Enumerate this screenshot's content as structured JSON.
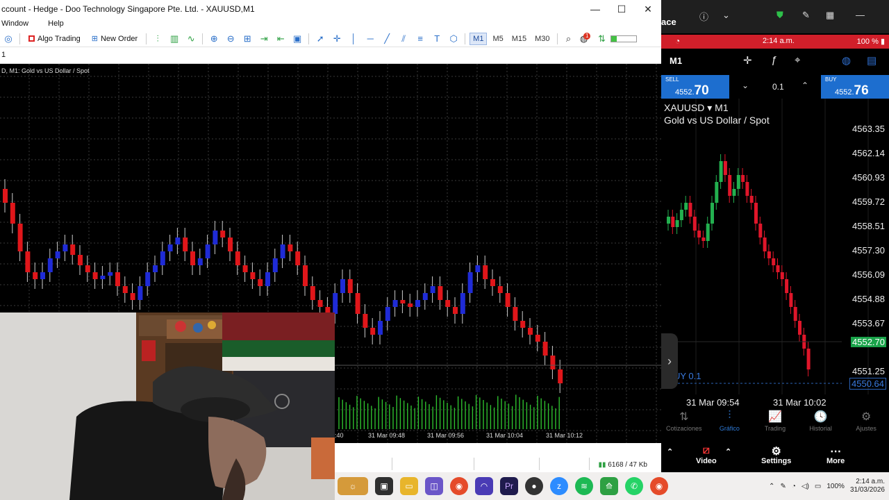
{
  "window": {
    "title": "ccount - Hedge - Doo Technology Singapore Pte. Ltd. - XAUUSD,M1",
    "minimize": "—",
    "maximize": "☐",
    "close": "✕"
  },
  "menu": [
    "Window",
    "Help"
  ],
  "toolbar": {
    "algo_trading": "Algo Trading",
    "new_order": "New Order",
    "timeframes": [
      "M1",
      "M5",
      "M15",
      "M30"
    ],
    "notification_count": "1"
  },
  "tab_row": {
    "label": "1"
  },
  "chart": {
    "label": "D, M1: Gold vs US Dollar / Spot",
    "time_labels": [
      ":40",
      "31 Mar 09:48",
      "31 Mar 09:56",
      "31 Mar 10:04",
      "31 Mar 10:12"
    ],
    "colors": {
      "bull": "#1f2bd6",
      "bear": "#e0161a",
      "volume": "#2ec02e",
      "grid": "#3a3a3a"
    }
  },
  "status": {
    "network": "6168 / 47 Kb"
  },
  "mirror": {
    "header_text": "ace",
    "phone_time": "2:14 a.m.",
    "battery": "100 %",
    "timeframe": "M1",
    "sell": {
      "label": "SELL",
      "price_small": "4552.",
      "price_big": "70"
    },
    "buy": {
      "label": "BUY",
      "price_small": "4552.",
      "price_big": "76"
    },
    "lot": "0.1",
    "symbol": "XAUUSD ▾ M1",
    "symbol_desc": "Gold vs US Dollar / Spot",
    "price_ticks": [
      "4563.35",
      "4562.14",
      "4560.93",
      "4559.72",
      "4558.51",
      "4557.30",
      "4556.09",
      "4554.88",
      "4553.67",
      "4552.70",
      "4551.25",
      "4550.64"
    ],
    "buy_tag": "UY 0.1",
    "dates": [
      "31 Mar 09:54",
      "31 Mar 10:02"
    ],
    "nav": [
      {
        "label": "Cotizaciones",
        "icon": "⇅"
      },
      {
        "label": "Gráfico",
        "icon": "⫶"
      },
      {
        "label": "Trading",
        "icon": "📈"
      },
      {
        "label": "Historial",
        "icon": "🕓"
      },
      {
        "label": "Ajustes",
        "icon": "⚙"
      }
    ],
    "bottom": {
      "video": "Video",
      "settings": "Settings",
      "more": "More"
    }
  },
  "taskbar": {
    "battery": "100%",
    "clock_time": "2:14 a.m.",
    "clock_date": "31/03/2026"
  }
}
